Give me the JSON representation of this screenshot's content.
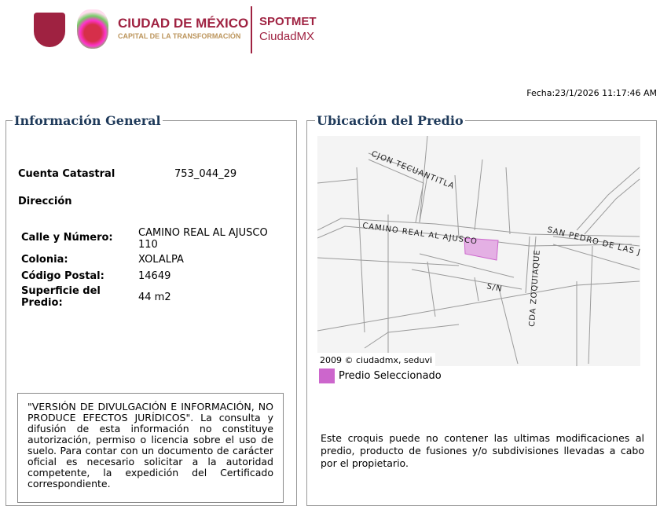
{
  "header": {
    "logo_text": "CIUDAD DE MÉXICO",
    "logo_subtitle": "CAPITAL DE LA TRANSFORMACIÓN",
    "app_name": "SPOTMET",
    "app_subtitle": "CiudadMX",
    "date": "Fecha:23/1/2026 11:17:46 AM"
  },
  "general": {
    "title": "Información General",
    "cuenta_label": "Cuenta Catastral",
    "cuenta_value": "753_044_29",
    "direccion_label": "Dirección",
    "fields": [
      {
        "label": "Calle y Número:",
        "value": "CAMINO REAL AL AJUSCO 110"
      },
      {
        "label": "Colonia:",
        "value": "XOLALPA"
      },
      {
        "label": "Código Postal:",
        "value": "14649"
      },
      {
        "label": "Superficie del Predio:",
        "value": "44 m2"
      }
    ],
    "disclaimer": "\"VERSIÓN DE DIVULGACIÓN E INFORMACIÓN, NO PRODUCE EFECTOS JURÍDICOS\". La consulta y difusión de esta información no constituye autorización, permiso o licencia sobre el uso de suelo. Para contar con un documento de carácter oficial es necesario solicitar a la autoridad competente, la expedición del Certificado correspondiente."
  },
  "ubicacion": {
    "title": "Ubicación del Predio",
    "streets": [
      "CJON TECUANTITLA",
      "CAMINO REAL AL AJUSCO",
      "SAN PEDRO DE LAS J",
      "CDA ZOQUIAQUE",
      "S/N"
    ],
    "copyright": "2009 © ciudadmx, seduvi",
    "legend": "Predio Seleccionado",
    "legend_color": "#cc66cc",
    "note": "Este croquis puede no contener las ultimas modificaciones al predio, producto de fusiones y/o subdivisiones llevadas a cabo por el propietario."
  }
}
